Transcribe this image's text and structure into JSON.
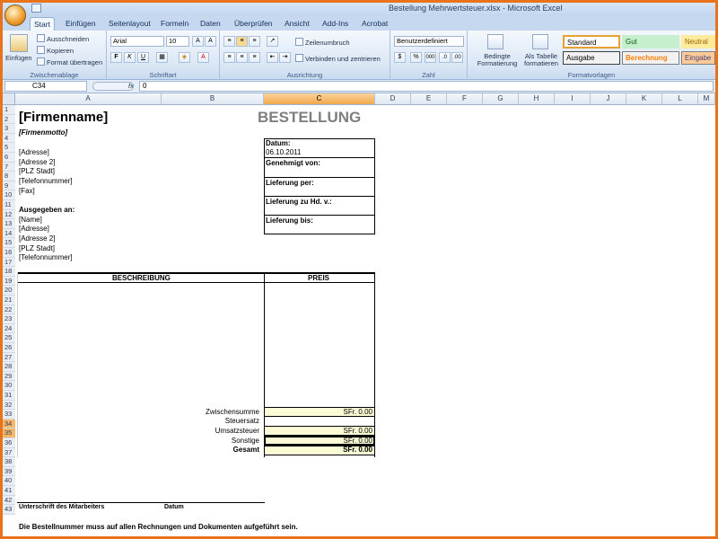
{
  "window": {
    "title": "Bestellung Mehrwertsteuer.xlsx - Microsoft Excel"
  },
  "tabs": [
    "Start",
    "Einfügen",
    "Seitenlayout",
    "Formeln",
    "Daten",
    "Überprüfen",
    "Ansicht",
    "Add-Ins",
    "Acrobat"
  ],
  "ribbon": {
    "clipboard": {
      "paste": "Einfügen",
      "cut": "Ausschneiden",
      "copy": "Kopieren",
      "format_painter": "Format übertragen",
      "label": "Zwischenablage"
    },
    "font": {
      "name": "Arial",
      "size": "10",
      "bold": "F",
      "italic": "K",
      "underline": "U",
      "label": "Schriftart"
    },
    "alignment": {
      "wrap": "Zeilenumbruch",
      "merge": "Verbinden und zentrieren",
      "label": "Ausrichtung"
    },
    "number": {
      "format": "Benutzerdefiniert",
      "percent": "%",
      "thousands": "000",
      "label": "Zahl"
    },
    "styles": {
      "conditional": "Bedingte Formatierung",
      "as_table": "Als Tabelle formatieren",
      "standard": "Standard",
      "gut": "Gut",
      "neutral": "Neutral",
      "ausgabe": "Ausgabe",
      "berechnung": "Berechnung",
      "eingabe": "Eingabe",
      "label": "Formatvorlagen"
    }
  },
  "formula_bar": {
    "cell": "C34",
    "fx": "fx",
    "value": "0"
  },
  "columns": [
    "A",
    "B",
    "C",
    "D",
    "E",
    "F",
    "G",
    "H",
    "I",
    "J",
    "K",
    "L",
    "M"
  ],
  "rows": [
    "1",
    "2",
    "3",
    "4",
    "5",
    "6",
    "7",
    "8",
    "9",
    "10",
    "11",
    "12",
    "13",
    "14",
    "15",
    "16",
    "17",
    "18",
    "19",
    "20",
    "21",
    "22",
    "23",
    "24",
    "25",
    "26",
    "27",
    "28",
    "29",
    "30",
    "31",
    "32",
    "33",
    "34",
    "35",
    "36",
    "37",
    "38",
    "39",
    "40",
    "41",
    "42",
    "43"
  ],
  "sheet": {
    "company": "[Firmenname]",
    "motto": "[Firmenmotto]",
    "title": "BESTELLUNG",
    "address": [
      "[Adresse]",
      "[Adresse 2]",
      "[PLZ Stadt]",
      "[Telefonnummer]",
      "[Fax]"
    ],
    "ship_to_label": "Ausgegeben an:",
    "ship_to": [
      "[Name]",
      "[Adresse]",
      "[Adresse 2]",
      "[PLZ Stadt]",
      "[Telefonnummer]"
    ],
    "info": {
      "date_label": "Datum:",
      "date_value": "06.10.2011",
      "approved": "Genehmigt von:",
      "delivery_by": "Lieferung per:",
      "delivery_to": "Lieferung zu Hd. v.:",
      "delivery_until": "Lieferung bis:"
    },
    "table": {
      "col_desc": "BESCHREIBUNG",
      "col_price": "PREIS"
    },
    "totals": [
      {
        "label": "Zwischensumme",
        "value": "SFr. 0.00",
        "highlight": true,
        "bold": false
      },
      {
        "label": "Steuersatz",
        "value": "",
        "highlight": false,
        "bold": false
      },
      {
        "label": "Umsatzsteuer",
        "value": "SFr. 0.00",
        "highlight": true,
        "bold": false
      },
      {
        "label": "Sonstige",
        "value": "SFr. 0.00",
        "highlight": true,
        "bold": false
      },
      {
        "label": "Gesamt",
        "value": "SFr. 0.00",
        "highlight": true,
        "bold": true
      }
    ],
    "signature": "Unterschrift des Mitarbeiters",
    "signature_date": "Datum",
    "footer": "Die Bestellnummer muss auf allen Rechnungen und Dokumenten aufgeführt sein."
  }
}
